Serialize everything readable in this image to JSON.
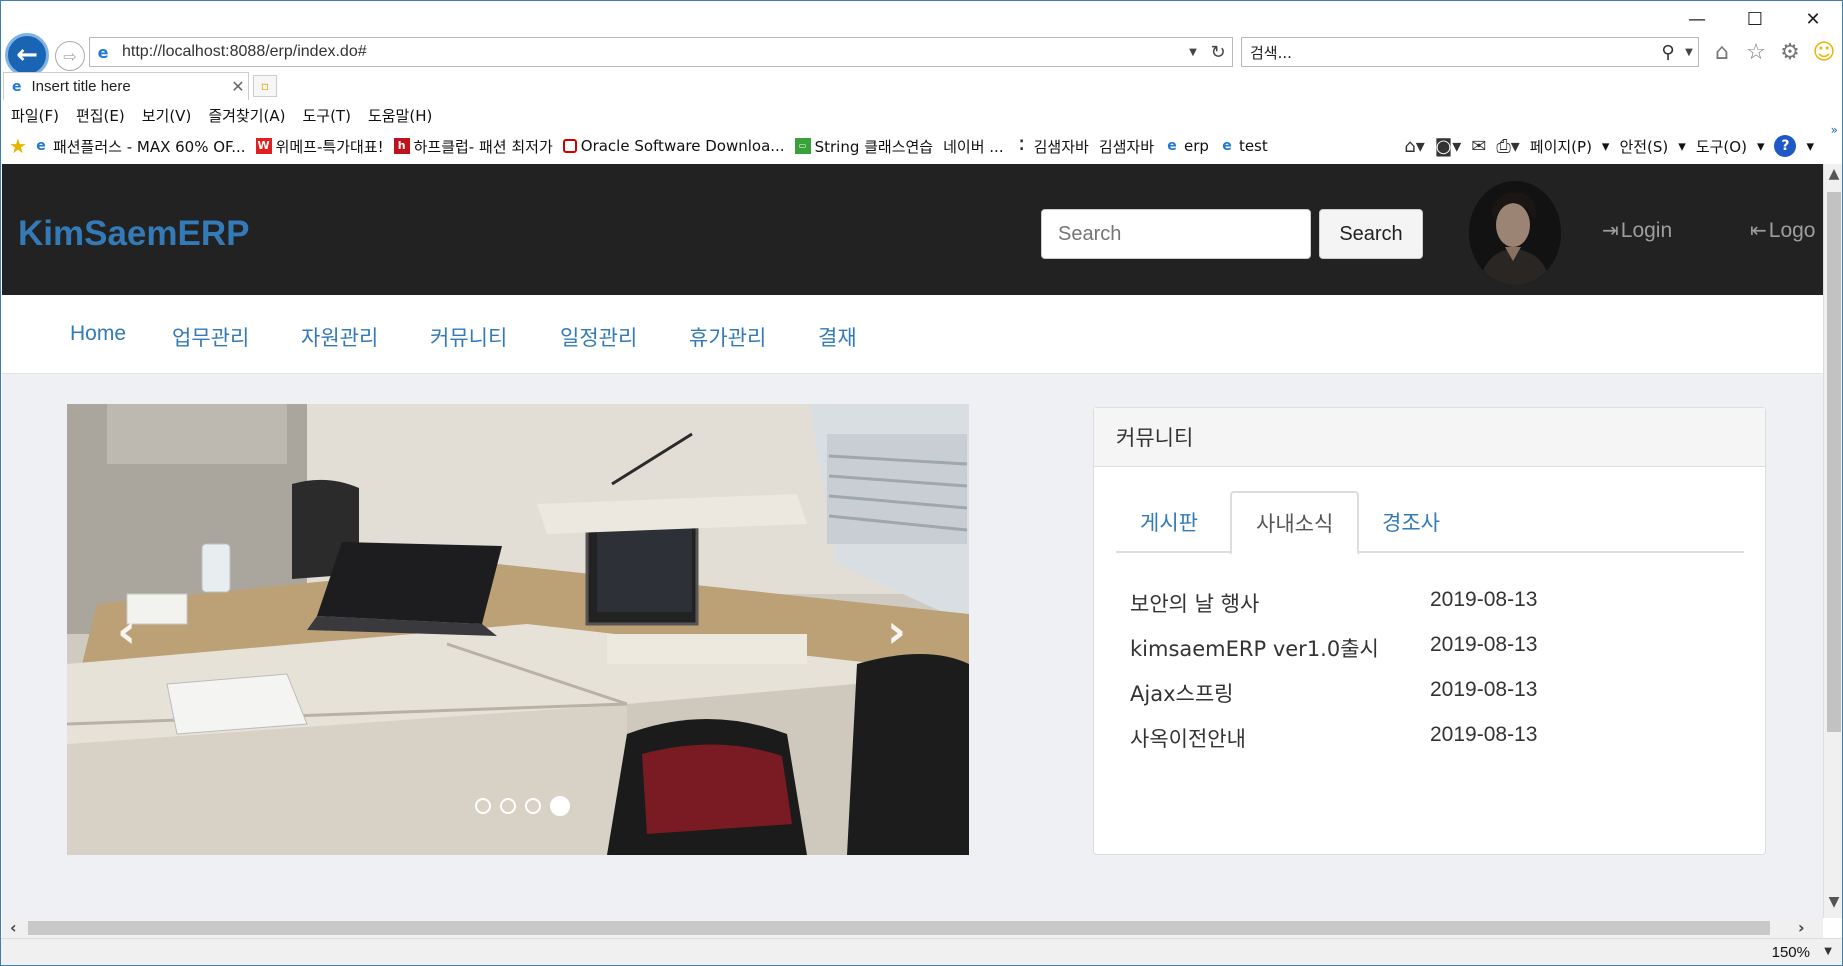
{
  "browser": {
    "window_controls": {
      "minimize": "—",
      "maximize": "☐",
      "close": "✕"
    },
    "url": "http://localhost:8088/erp/index.do#",
    "search_placeholder": "검색...",
    "tab_title": "Insert title here",
    "menu": [
      "파일(F)",
      "편집(E)",
      "보기(V)",
      "즐겨찾기(A)",
      "도구(T)",
      "도움말(H)"
    ],
    "favorites": [
      {
        "label": "패션플러스 - MAX 60% OF...",
        "icon": "ie-icon"
      },
      {
        "label": "위메프-특가대표!",
        "icon": "wemakeprice-icon"
      },
      {
        "label": "하프클럽- 패션 최저가",
        "icon": "halfclub-icon"
      },
      {
        "label": "Oracle Software Downloa...",
        "icon": "oracle-icon"
      },
      {
        "label": "String 클래스연습",
        "icon": "gallery-icon"
      },
      {
        "label": "네이버 ...",
        "icon": ""
      },
      {
        "label": "김샘자바",
        "icon": "dots-icon"
      },
      {
        "label": "김샘자바",
        "icon": ""
      },
      {
        "label": "erp",
        "icon": "ie-icon"
      },
      {
        "label": "test",
        "icon": "ie-icon"
      }
    ],
    "command_bar": {
      "page": "페이지(P)",
      "safety": "안전(S)",
      "tools": "도구(O)"
    },
    "zoom": "150%"
  },
  "page": {
    "brand": "KimSaemERP",
    "search_placeholder": "Search",
    "search_button": "Search",
    "login": "Login",
    "logout": "Logo",
    "nav": [
      "Home",
      "업무관리",
      "자원관리",
      "커뮤니티",
      "일정관리",
      "휴가관리",
      "결재"
    ],
    "carousel": {
      "slide_count": 4,
      "active_index": 3,
      "prev_icon": "‹",
      "next_icon": "›"
    },
    "community": {
      "title": "커뮤니티",
      "tabs": [
        "게시판",
        "사내소식",
        "경조사"
      ],
      "active_tab": 1,
      "items": [
        {
          "title": "보안의 날 행사",
          "date": "2019-08-13"
        },
        {
          "title": "kimsaemERP ver1.0출시",
          "date": "2019-08-13"
        },
        {
          "title": "Ajax스프링",
          "date": "2019-08-13"
        },
        {
          "title": "사옥이전안내",
          "date": "2019-08-13"
        }
      ]
    }
  }
}
